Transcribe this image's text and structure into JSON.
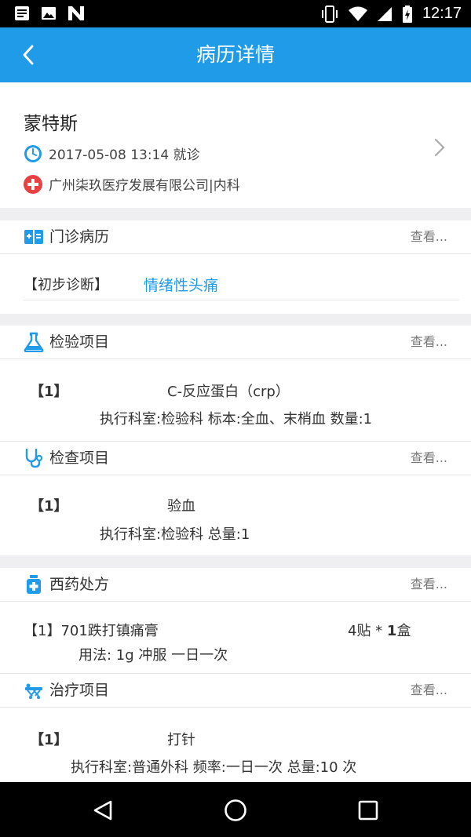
{
  "status_bar": {
    "time": "12:17",
    "icons_left": [
      "notes-icon",
      "image-icon",
      "n-app-icon"
    ],
    "icons_right": [
      "vibrate-icon",
      "wifi-icon",
      "signal-icon",
      "battery-icon"
    ]
  },
  "app_bar": {
    "title": "病历详情"
  },
  "patient": {
    "name": "蒙特斯",
    "visit_time": "2017-05-08 13:14 就诊",
    "hospital": "广州柒玖医疗发展有限公司|内科"
  },
  "outpatient": {
    "title": "门诊病历",
    "more": "查看...",
    "diagnosis_label": "【初步诊断】",
    "diagnosis_value": "情绪性头痛"
  },
  "lab_tests": {
    "title": "检验项目",
    "more": "查看...",
    "item_index": "【1】",
    "item_name": "C-反应蛋白（crp）",
    "item_detail": "执行科室:检验科 标本:全血、末梢血 数量:1"
  },
  "exams": {
    "title": "检查项目",
    "more": "查看...",
    "item_index": "【1】",
    "item_name": "验血",
    "item_detail": "执行科室:检验科 总量:1"
  },
  "prescription": {
    "title": "西药处方",
    "more": "查看...",
    "item_name": "【1】701跌打镇痛膏",
    "qty_prefix": "4贴 * ",
    "qty_bold": "1",
    "qty_unit": "盒",
    "usage": "用法: 1g  冲服  一日一次"
  },
  "treatment": {
    "title": "治疗项目",
    "more": "查看...",
    "item_index": "【1】",
    "item_name": "打针",
    "item_detail": "执行科室:普通外科 频率:一日一次 总量:10 次"
  },
  "colors": {
    "primary": "#1f9be8",
    "hospital_icon": "#e84141",
    "link_blue": "#1f9be8"
  }
}
